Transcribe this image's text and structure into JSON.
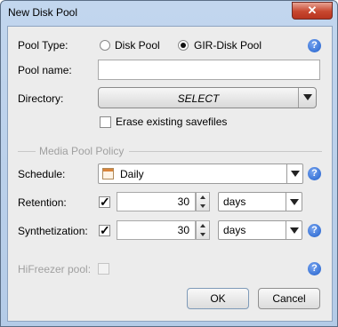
{
  "window": {
    "title": "New Disk Pool",
    "close_glyph": "✕"
  },
  "pool_type": {
    "label": "Pool Type:",
    "options": [
      {
        "label": "Disk Pool",
        "selected": false
      },
      {
        "label": "GIR-Disk Pool",
        "selected": true
      }
    ]
  },
  "pool_name": {
    "label": "Pool name:",
    "value": ""
  },
  "directory": {
    "label": "Directory:",
    "button_label": "SELECT"
  },
  "erase": {
    "label": "Erase existing savefiles",
    "checked": false
  },
  "media_policy": {
    "group_label": "Media Pool Policy",
    "schedule": {
      "label": "Schedule:",
      "value": "Daily"
    },
    "retention": {
      "label": "Retention:",
      "checked": true,
      "value": "30",
      "unit": "days"
    },
    "synthetization": {
      "label": "Synthetization:",
      "checked": true,
      "value": "30",
      "unit": "days"
    }
  },
  "hifreezer": {
    "label": "HiFreezer pool:",
    "checked": false
  },
  "buttons": {
    "ok": "OK",
    "cancel": "Cancel"
  },
  "help_glyph": "?",
  "checkmark_glyph": "✓",
  "colors": {
    "help_blue": "#1f5fcc",
    "close_red": "#c7472f",
    "title_blue": "#b4cbe7"
  }
}
